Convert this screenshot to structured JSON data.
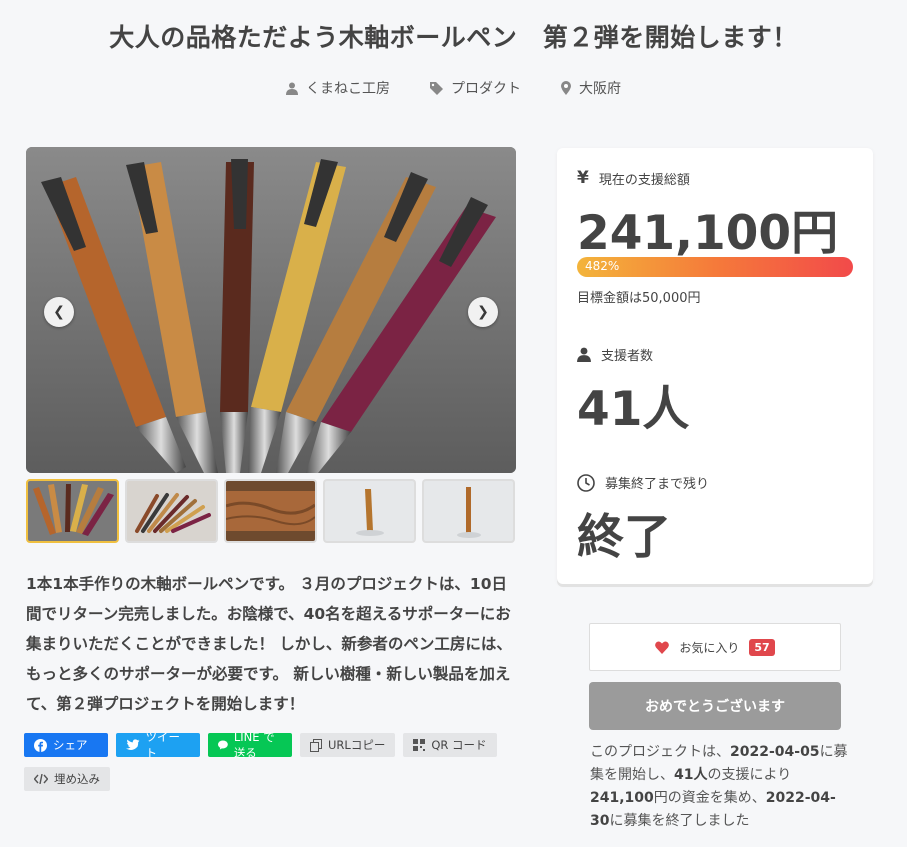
{
  "project": {
    "title": "大人の品格ただよう木軸ボールペン　第２弾を開始します！",
    "owner": "くまねこ工房",
    "category": "プロダクト",
    "location": "大阪府"
  },
  "gallery": {
    "prev_label": "❮",
    "next_label": "❯",
    "active_index": 0,
    "thumb_count": 5
  },
  "description": "1本1本手作りの木軸ボールペンです。 ３月のプロジェクトは、10日間でリターン完売しました。お陰様で、40名を超えるサポーターにお集まりいただくことができました！ しかし、新参者のペン工房には、もっと多くのサポーターが必要です。 新しい樹種・新しい製品を加えて、第２弾プロジェクトを開始します！",
  "share": {
    "facebook": "シェア",
    "twitter": "ツイート",
    "line": "LINE で送る",
    "url_copy": "URLコピー",
    "qr": "QR コード",
    "embed": "埋め込み"
  },
  "stats": {
    "amount_label": "現在の支援総額",
    "amount_icon": "yen-icon",
    "amount_symbol": "¥",
    "amount": "241,100円",
    "percent_text": "482%",
    "percent_value": 482,
    "goal_text": "目標金額は50,000円",
    "backers_label": "支援者数",
    "backers": "41人",
    "remaining_label": "募集終了まで残り",
    "remaining": "終了"
  },
  "favorite": {
    "label": "お気に入り",
    "count": "57"
  },
  "status_button": "おめでとうございます",
  "summary": {
    "p1": "このプロジェクトは、",
    "start_date": "2022-04-05",
    "p2": "に募集を開始し、",
    "backers": "41人",
    "p3": "の支援により",
    "amount": "241,100",
    "p4": "円の資金を集め、",
    "end_date": "2022-04-30",
    "p5": "に募集を終了しました"
  },
  "colors": {
    "accent_gradient_start": "#f3b43b",
    "accent_gradient_end": "#f24a4a",
    "favorite_badge": "#e0474c",
    "facebook": "#1877f2",
    "twitter": "#1da1f2",
    "line": "#06c755"
  }
}
